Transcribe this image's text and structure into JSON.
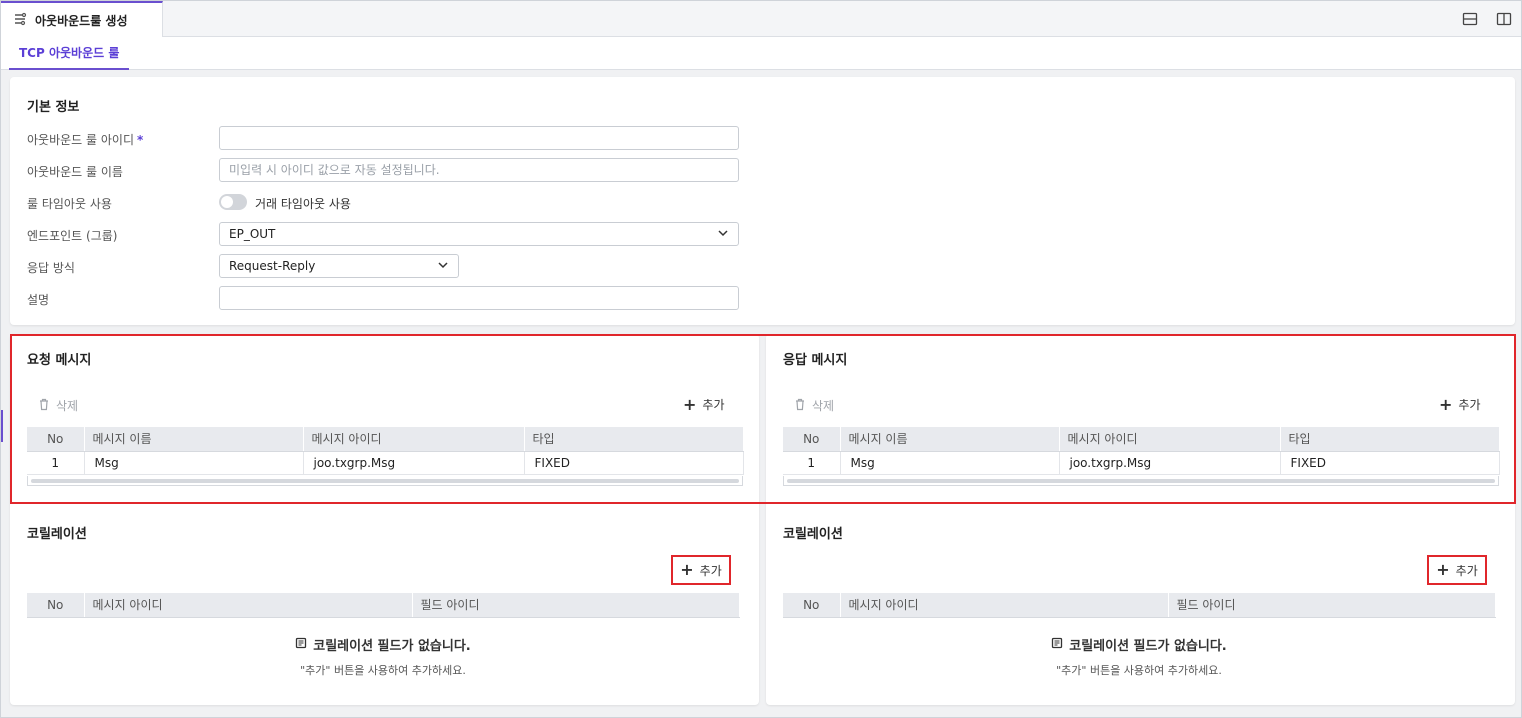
{
  "tab": {
    "title": "아웃바운드룰 생성",
    "icon": "route-icon"
  },
  "window_controls": [
    {
      "icon": "split-horizontal-icon"
    },
    {
      "icon": "split-vertical-icon"
    }
  ],
  "subtab": {
    "label": "TCP 아웃바운드 룰"
  },
  "basic_info": {
    "title": "기본 정보",
    "rule_id": {
      "label": "아웃바운드 룰 아이디",
      "required_mark": "*",
      "value": ""
    },
    "rule_name": {
      "label": "아웃바운드 룰 이름",
      "placeholder": "미입력 시 아이디 값으로 자동 설정됩니다.",
      "value": ""
    },
    "timeout": {
      "label": "룰 타임아웃 사용",
      "toggle_label": "거래 타임아웃 사용",
      "enabled": false
    },
    "endpoint": {
      "label": "엔드포인트 (그룹)",
      "value": "EP_OUT"
    },
    "response_mode": {
      "label": "응답 방식",
      "value": "Request-Reply"
    },
    "description": {
      "label": "설명",
      "value": ""
    }
  },
  "request_message": {
    "title": "요청 메시지",
    "delete_label": "삭제",
    "add_label": "추가",
    "columns": [
      "No",
      "메시지 이름",
      "메시지 아이디",
      "타입"
    ],
    "rows": [
      {
        "no": "1",
        "name": "Msg",
        "id": "joo.txgrp.Msg",
        "type": "FIXED"
      }
    ]
  },
  "response_message": {
    "title": "응답 메시지",
    "delete_label": "삭제",
    "add_label": "추가",
    "columns": [
      "No",
      "메시지 이름",
      "메시지 아이디",
      "타입"
    ],
    "rows": [
      {
        "no": "1",
        "name": "Msg",
        "id": "joo.txgrp.Msg",
        "type": "FIXED"
      }
    ]
  },
  "request_correlation": {
    "title": "코릴레이션",
    "add_label": "추가",
    "columns": [
      "No",
      "메시지 아이디",
      "필드 아이디"
    ],
    "empty_title": "코릴레이션 필드가 없습니다.",
    "empty_hint": "\"추가\" 버튼을 사용하여 추가하세요."
  },
  "response_correlation": {
    "title": "코릴레이션",
    "add_label": "추가",
    "columns": [
      "No",
      "메시지 아이디",
      "필드 아이디"
    ],
    "empty_title": "코릴레이션 필드가 없습니다.",
    "empty_hint": "\"추가\" 버튼을 사용하여 추가하세요."
  },
  "colors": {
    "accent": "#6a4fcf",
    "highlight": "#e0262b"
  }
}
